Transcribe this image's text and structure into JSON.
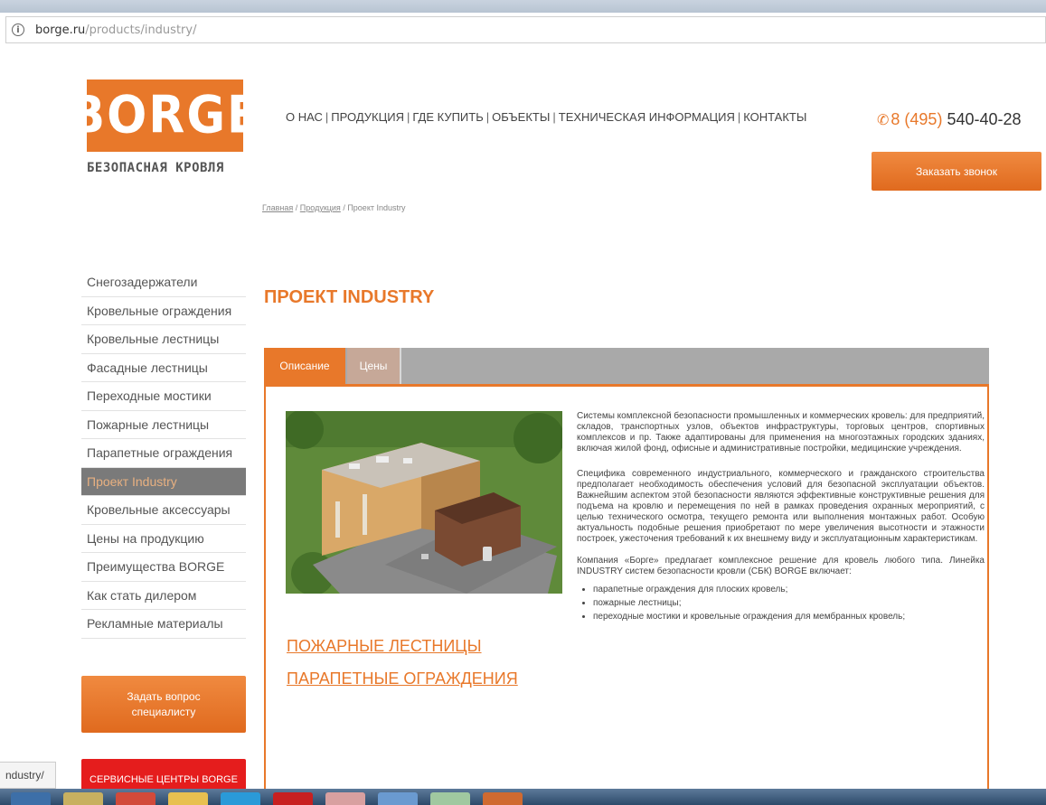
{
  "browser": {
    "url_host": "borge.ru",
    "url_path": "/products/industry/",
    "status_url": "ndustry/"
  },
  "header": {
    "logo_text": "BORGE",
    "tagline": "БЕЗОПАСНАЯ КРОВЛЯ",
    "nav": [
      "О НАС",
      "ПРОДУКЦИЯ",
      "ГДЕ КУПИТЬ",
      "ОБЪЕКТЫ",
      "ТЕХНИЧЕСКАЯ ИНФОРМАЦИЯ",
      "КОНТАКТЫ"
    ],
    "nav_separator": "|",
    "phone_code": "8 (495)",
    "phone_number": "540-40-28",
    "callback_label": "Заказать звонок"
  },
  "breadcrumb": {
    "home": "Главная",
    "products": "Продукция",
    "current": "Проект Industry",
    "sep": " / "
  },
  "sidebar": {
    "items": [
      "Снегозадержатели",
      "Кровельные ограждения",
      "Кровельные лестницы",
      "Фасадные лестницы",
      "Переходные мостики",
      "Пожарные лестницы",
      "Парапетные ограждения",
      "Проект Industry",
      "Кровельные аксессуары",
      "Цены на продукцию",
      "Преимущества BORGE",
      "Как стать дилером",
      "Рекламные материалы"
    ],
    "active_index": 7,
    "ask_button": "Задать вопрос специалисту",
    "service_button": "СЕРВИСНЫЕ ЦЕНТРЫ BORGE"
  },
  "main": {
    "title": "ПРОЕКТ INDUSTRY",
    "tabs": [
      "Описание",
      "Цены"
    ],
    "links": [
      "ПОЖАРНЫЕ ЛЕСТНИЦЫ",
      "ПАРАПЕТНЫЕ ОГРАЖДЕНИЯ"
    ],
    "paragraphs": [
      "Системы комплексной безопасности промышленных и коммерческих кровель: для предприятий, складов, транспортных узлов, объектов инфраструктуры, торговых центров, спортивных комплексов и пр. Также адаптированы для применения на многоэтажных городских зданиях, включая жилой фонд, офисные и административные постройки, медицинские учреждения.",
      "Специфика современного индустриального, коммерческого и гражданского строительства предполагает необходимость обеспечения условий для безопасной эксплуатации объектов. Важнейшим аспектом этой безопасности являются эффективные конструктивные решения для подъема на кровлю и перемещения по ней в рамках проведения охранных мероприятий, с целью технического осмотра, текущего ремонта или выполнения монтажных работ. Особую актуальность подобные решения приобретают по мере увеличения высотности и этажности построек, ужесточения требований к их внешнему виду и эксплуатационным характеристикам.",
      "Компания «Борге» предлагает комплексное решение для кровель любого типа. Линейка INDUSTRY систем безопасности кровли (СБК) BORGE включает:"
    ],
    "bullets": [
      "парапетные ограждения для плоских кровель;",
      "пожарные лестницы;",
      "переходные мостики и кровельные ограждения для мембранных кровель;"
    ]
  },
  "colors": {
    "accent": "#e8782a",
    "sidebar_active_bg": "#7a7a7a",
    "tab_bar": "#a9a9a9",
    "service_red": "#e51d1d"
  }
}
